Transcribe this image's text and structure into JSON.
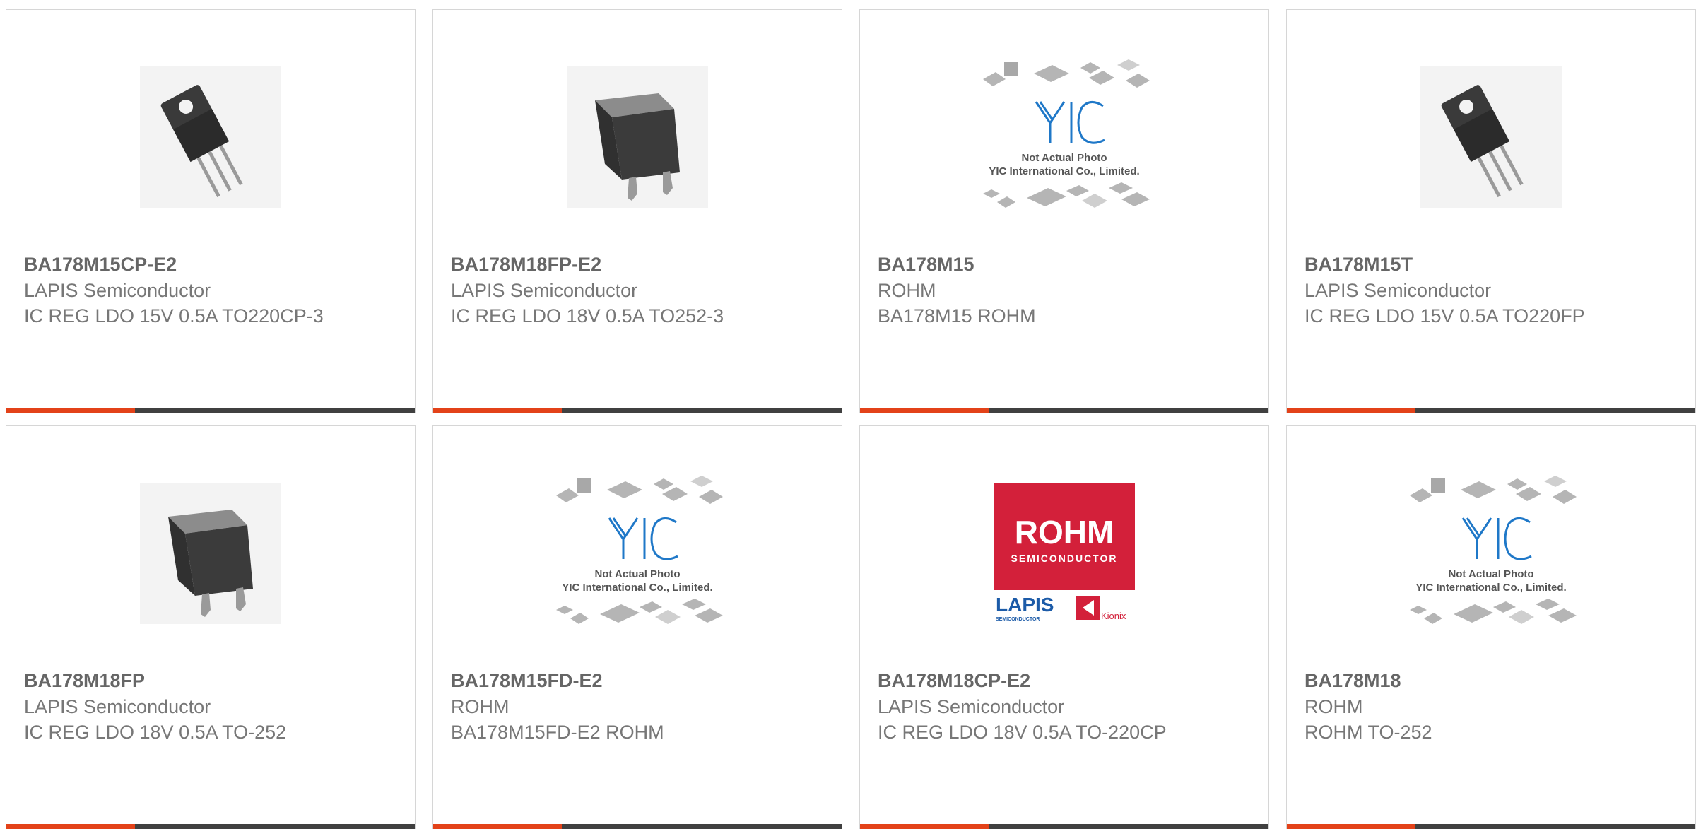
{
  "colors": {
    "accent": "#e34219",
    "bar": "#404040",
    "text": "#777777",
    "border": "#d6d6d6",
    "rohm_red": "#d3203a",
    "lapis_blue": "#1c5ba8",
    "yic_blue": "#1f78c8"
  },
  "placeholder": {
    "line1": "Not Actual Photo",
    "line2": "YIC International Co., Limited."
  },
  "rohm_logo": {
    "brand": "ROHM",
    "sub": "SEMICONDUCTOR",
    "lapis": "LAPIS",
    "lapis_sub": "SEMICONDUCTOR",
    "kionix": "Kionix"
  },
  "products": [
    {
      "part": "BA178M15CP-E2",
      "manufacturer": "LAPIS Semiconductor",
      "description": "IC REG LDO 15V 0.5A TO220CP-3",
      "image": "to220-icon"
    },
    {
      "part": "BA178M18FP-E2",
      "manufacturer": "LAPIS Semiconductor",
      "description": "IC REG LDO 18V 0.5A TO252-3",
      "image": "to252-icon"
    },
    {
      "part": "BA178M15",
      "manufacturer": "ROHM",
      "description": "BA178M15 ROHM",
      "image": "placeholder-icon"
    },
    {
      "part": "BA178M15T",
      "manufacturer": "LAPIS Semiconductor",
      "description": "IC REG LDO 15V 0.5A TO220FP",
      "image": "to220-icon"
    },
    {
      "part": "BA178M18FP",
      "manufacturer": "LAPIS Semiconductor",
      "description": "IC REG LDO 18V 0.5A TO-252",
      "image": "to252-icon"
    },
    {
      "part": "BA178M15FD-E2",
      "manufacturer": "ROHM",
      "description": "BA178M15FD-E2 ROHM",
      "image": "placeholder-icon"
    },
    {
      "part": "BA178M18CP-E2",
      "manufacturer": "LAPIS Semiconductor",
      "description": "IC REG LDO 18V 0.5A TO-220CP",
      "image": "rohm-logo-icon"
    },
    {
      "part": "BA178M18",
      "manufacturer": "ROHM",
      "description": "ROHM TO-252",
      "image": "placeholder-icon"
    }
  ]
}
